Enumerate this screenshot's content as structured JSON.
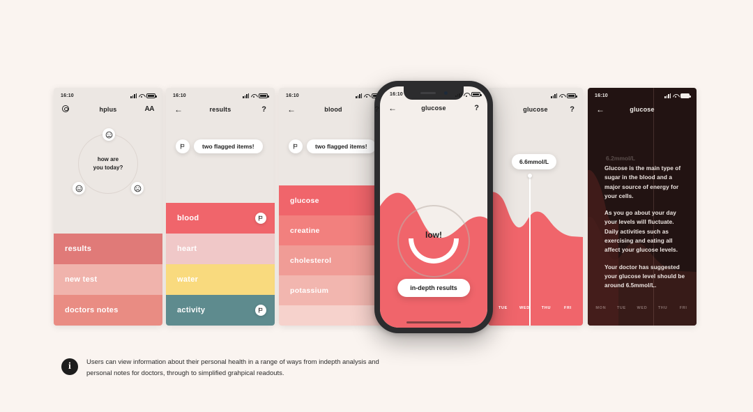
{
  "background_color": "#faf4f0",
  "status_bar": {
    "time": "16:10",
    "signal_icon": "signal-bars-icon",
    "wifi_icon": "wifi-icon",
    "battery_icon": "battery-icon"
  },
  "colors": {
    "coral": "#F0656B",
    "coral_light": "#F08A8C",
    "pink": "#F0C8C8",
    "pink_pale": "#F3D3D1",
    "pink_faint": "#F6DDDB",
    "yellow": "#F9DA7E",
    "teal": "#5E8B8E",
    "screen_bg": "#ece7e3",
    "dark_bg": "#221312",
    "salmon": "#E07A78",
    "salmon_light": "#F0B3AC",
    "salmon_mid": "#E98C83"
  },
  "screens": [
    {
      "id": "home",
      "nav": {
        "left_icon": "gear-icon",
        "title": "hplus",
        "right_icon": "text-size-icon",
        "right_label": "AA"
      },
      "mood": {
        "question_line1": "how are",
        "question_line2": "you today?",
        "faces": [
          {
            "name": "neutral-face-icon",
            "glyph": "☹"
          },
          {
            "name": "happy-face-icon",
            "glyph": "☺"
          },
          {
            "name": "sad-face-icon",
            "glyph": "☹"
          }
        ]
      },
      "menu": [
        {
          "label": "results",
          "color": "#E07A78"
        },
        {
          "label": "new test",
          "color": "#F0B3AC"
        },
        {
          "label": "doctors notes",
          "color": "#E98C83"
        }
      ]
    },
    {
      "id": "results",
      "nav": {
        "left_icon": "back-arrow-icon",
        "title": "results",
        "right_icon": "help-icon",
        "right_label": "?"
      },
      "toast": {
        "icon": "flag-icon",
        "text": "two flagged items!"
      },
      "items": [
        {
          "label": "blood",
          "color": "#F0656B",
          "flagged": true
        },
        {
          "label": "heart",
          "color": "#F0C8C8",
          "flagged": false
        },
        {
          "label": "water",
          "color": "#F9DA7E",
          "flagged": false
        },
        {
          "label": "activity",
          "color": "#5E8B8E",
          "flagged": true
        }
      ]
    },
    {
      "id": "blood",
      "nav": {
        "left_icon": "back-arrow-icon",
        "title": "blood",
        "right_icon": "help-icon",
        "right_label": "?"
      },
      "toast": {
        "icon": "flag-icon",
        "text": "two flagged items!"
      },
      "items": [
        {
          "label": "glucose",
          "color": "#F0656B"
        },
        {
          "label": "creatine",
          "color": "#F2807E"
        },
        {
          "label": "cholesterol",
          "color": "#F09C96"
        },
        {
          "label": "potassium",
          "color": "#F2B6AF"
        },
        {
          "label": "",
          "color": "#F6D2CC"
        }
      ]
    },
    {
      "id": "glucose-summary",
      "nav": {
        "left_icon": "back-arrow-icon",
        "title": "glucose",
        "right_icon": "help-icon",
        "right_label": "?"
      },
      "status": "low!",
      "cta_label": "in-depth results"
    },
    {
      "id": "glucose-chart",
      "nav": {
        "left_icon": "back-arrow-icon",
        "title": "glucose",
        "right_icon": "help-icon",
        "right_label": "?"
      },
      "value_pill": "6.6mmol/L",
      "day_labels": [
        "TUE",
        "WED",
        "THU",
        "FRI"
      ]
    },
    {
      "id": "glucose-info",
      "nav": {
        "left_icon": "back-arrow-icon",
        "title": "glucose",
        "right_icon": "",
        "right_label": ""
      },
      "faded_value": "6.2mmol/L",
      "paragraphs": [
        "Glucose is the main type of sugar in the blood and a major source of energy for your cells.",
        "As you go about your day your levels will fluctuate. Daily activities such as exercising and eating all affect your glucose levels.",
        "Your doctor has suggested your glucose level should be around 6.5mmol/L."
      ],
      "day_labels": [
        "MON",
        "TUE",
        "WED",
        "THU",
        "FRI"
      ]
    }
  ],
  "caption": {
    "icon": "info-icon",
    "icon_glyph": "i",
    "text": "Users can view information about their personal health in a range of ways from indepth analysis and personal notes for doctors, through to simplified grahpical readouts."
  },
  "chart_data": {
    "type": "area",
    "title": "glucose",
    "xlabel": "",
    "ylabel": "mmol/L",
    "categories": [
      "TUE",
      "WED",
      "THU",
      "FRI"
    ],
    "values": [
      7.4,
      6.0,
      6.6,
      5.9
    ],
    "annotation": "6.6mmol/L",
    "target": 6.5,
    "grid": false,
    "legend": "none"
  }
}
